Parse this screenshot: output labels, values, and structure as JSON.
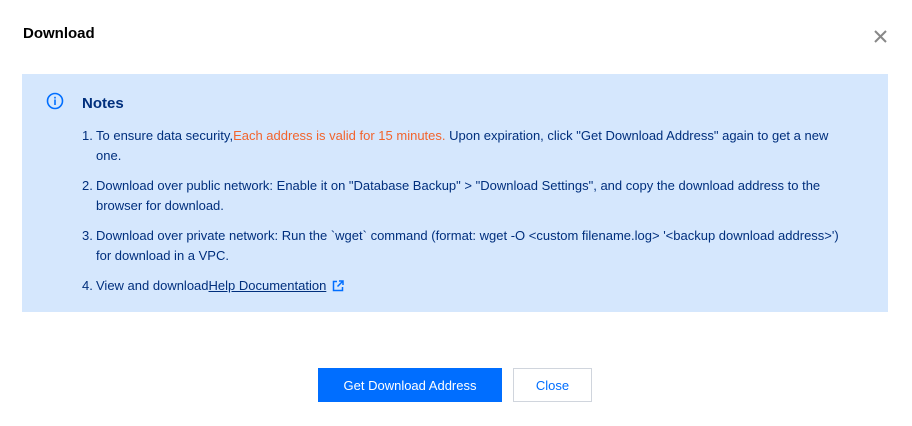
{
  "dialog": {
    "title": "Download",
    "close_icon": "close-icon"
  },
  "notice": {
    "icon": "info-circle-icon",
    "title": "Notes",
    "items": [
      {
        "number": "1.",
        "text_before": "To ensure data security,",
        "highlight": "Each address is valid for 15 minutes.",
        "text_after": " Upon expiration, click \"Get Download Address\" again to get a new one."
      },
      {
        "number": "2.",
        "text": "Download over public network: Enable it on \"Database Backup\" > \"Download Settings\", and copy the download address to the browser for download."
      },
      {
        "number": "3.",
        "text": "Download over private network: Run the `wget` command (format: wget -O <custom filename.log> '<backup download address>') for download in a VPC."
      },
      {
        "number": "4.",
        "text": "View and download",
        "link": "Help Documentation",
        "link_icon": "external-link-icon"
      }
    ]
  },
  "buttons": {
    "primary": "Get Download Address",
    "secondary": "Close"
  },
  "colors": {
    "notice_bg": "#d5e7fd",
    "notice_text": "#002f7d",
    "highlight": "#f2642d",
    "primary": "#006eff",
    "close_icon": "#888888"
  }
}
